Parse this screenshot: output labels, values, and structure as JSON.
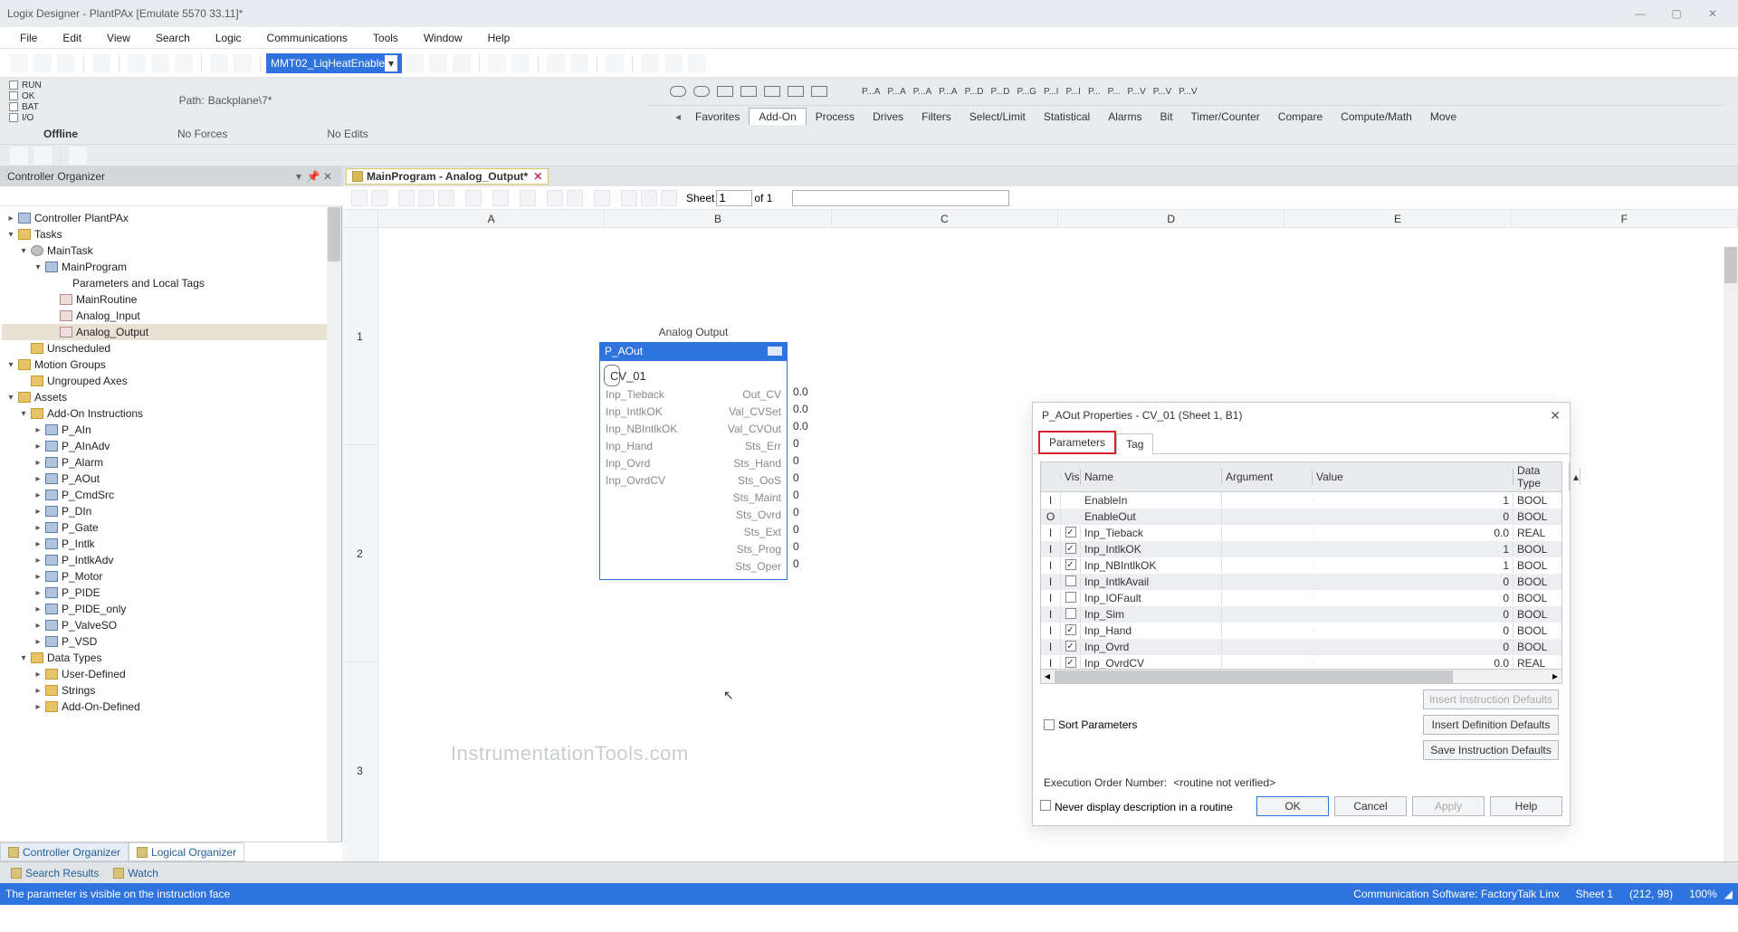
{
  "title": "Logix Designer - PlantPAx [Emulate 5570 33.11]*",
  "menu": [
    "File",
    "Edit",
    "View",
    "Search",
    "Logic",
    "Communications",
    "Tools",
    "Window",
    "Help"
  ],
  "address_dd": "MMT02_LiqHeatEnable",
  "status_leds": [
    "RUN",
    "OK",
    "BAT",
    "I/O"
  ],
  "path_label": "Path:",
  "path_value": "Backplane\\7*",
  "offline": "Offline",
  "noforces": "No Forces",
  "noedits": "No Edits",
  "inst_text": [
    "P...A",
    "P...A",
    "P...A",
    "P...A",
    "P...D",
    "P...D",
    "P...G",
    "P...I",
    "P...I",
    "P...",
    "P...",
    "P...V",
    "P...V",
    "P...V"
  ],
  "inst_tabs": [
    "Favorites",
    "Add-On",
    "Process",
    "Drives",
    "Filters",
    "Select/Limit",
    "Statistical",
    "Alarms",
    "Bit",
    "Timer/Counter",
    "Compare",
    "Compute/Math",
    "Move"
  ],
  "inst_tab_active": "Add-On",
  "organizer": {
    "title": "Controller Organizer",
    "tree": [
      {
        "lvl": 0,
        "tw": "▸",
        "ic": "ctrl",
        "label": "Controller PlantPAx"
      },
      {
        "lvl": 0,
        "tw": "▾",
        "ic": "folder",
        "label": "Tasks"
      },
      {
        "lvl": 1,
        "tw": "▾",
        "ic": "gear",
        "label": "MainTask"
      },
      {
        "lvl": 2,
        "tw": "▾",
        "ic": "ctrl",
        "label": "MainProgram"
      },
      {
        "lvl": 3,
        "tw": "",
        "ic": "",
        "label": "Parameters and Local Tags",
        "tint": "y"
      },
      {
        "lvl": 3,
        "tw": "",
        "ic": "rung",
        "label": "MainRoutine"
      },
      {
        "lvl": 3,
        "tw": "",
        "ic": "rung",
        "label": "Analog_Input"
      },
      {
        "lvl": 3,
        "tw": "",
        "ic": "rung",
        "label": "Analog_Output",
        "sel": true
      },
      {
        "lvl": 1,
        "tw": "",
        "ic": "folder",
        "label": "Unscheduled"
      },
      {
        "lvl": 0,
        "tw": "▾",
        "ic": "folder",
        "label": "Motion Groups"
      },
      {
        "lvl": 1,
        "tw": "",
        "ic": "folder",
        "label": "Ungrouped Axes"
      },
      {
        "lvl": 0,
        "tw": "▾",
        "ic": "folder",
        "label": "Assets"
      },
      {
        "lvl": 1,
        "tw": "▾",
        "ic": "folder",
        "label": "Add-On Instructions"
      },
      {
        "lvl": 2,
        "tw": "▸",
        "ic": "ctrl",
        "label": "P_AIn"
      },
      {
        "lvl": 2,
        "tw": "▸",
        "ic": "ctrl",
        "label": "P_AInAdv"
      },
      {
        "lvl": 2,
        "tw": "▸",
        "ic": "ctrl",
        "label": "P_Alarm"
      },
      {
        "lvl": 2,
        "tw": "▸",
        "ic": "ctrl",
        "label": "P_AOut"
      },
      {
        "lvl": 2,
        "tw": "▸",
        "ic": "ctrl",
        "label": "P_CmdSrc"
      },
      {
        "lvl": 2,
        "tw": "▸",
        "ic": "ctrl",
        "label": "P_DIn"
      },
      {
        "lvl": 2,
        "tw": "▸",
        "ic": "ctrl",
        "label": "P_Gate"
      },
      {
        "lvl": 2,
        "tw": "▸",
        "ic": "ctrl",
        "label": "P_Intlk"
      },
      {
        "lvl": 2,
        "tw": "▸",
        "ic": "ctrl",
        "label": "P_IntlkAdv"
      },
      {
        "lvl": 2,
        "tw": "▸",
        "ic": "ctrl",
        "label": "P_Motor"
      },
      {
        "lvl": 2,
        "tw": "▸",
        "ic": "ctrl",
        "label": "P_PIDE"
      },
      {
        "lvl": 2,
        "tw": "▸",
        "ic": "ctrl",
        "label": "P_PIDE_only"
      },
      {
        "lvl": 2,
        "tw": "▸",
        "ic": "ctrl",
        "label": "P_ValveSO"
      },
      {
        "lvl": 2,
        "tw": "▸",
        "ic": "ctrl",
        "label": "P_VSD"
      },
      {
        "lvl": 1,
        "tw": "▾",
        "ic": "folder",
        "label": "Data Types"
      },
      {
        "lvl": 2,
        "tw": "▸",
        "ic": "folder",
        "label": "User-Defined"
      },
      {
        "lvl": 2,
        "tw": "▸",
        "ic": "folder",
        "label": "Strings"
      },
      {
        "lvl": 2,
        "tw": "▸",
        "ic": "folder",
        "label": "Add-On-Defined"
      }
    ],
    "tabs": [
      "Controller Organizer",
      "Logical Organizer"
    ]
  },
  "bottomtabs": [
    "Search Results",
    "Watch"
  ],
  "statusbar": {
    "msg": "The parameter is visible on the instruction face",
    "comm": "Communication Software: FactoryTalk Linx",
    "sheet": "Sheet 1",
    "coord": "(212, 98)",
    "zoom": "100%"
  },
  "editor": {
    "tab": "MainProgram - Analog_Output*",
    "sheet_label": "Sheet",
    "sheet_val": "1",
    "sheet_of": "of  1",
    "cols": [
      "A",
      "B",
      "C",
      "D",
      "E",
      "F"
    ],
    "rows": [
      "1",
      "2",
      "3"
    ],
    "fblock": {
      "caption": "Analog Output",
      "name": "P_AOut",
      "tag": "CV_01",
      "ioL": [
        "Inp_Tieback",
        "Inp_IntlkOK",
        "Inp_NBIntlkOK",
        "Inp_Hand",
        "Inp_Ovrd",
        "Inp_OvrdCV"
      ],
      "ioR": [
        "Out_CV",
        "Val_CVSet",
        "Val_CVOut",
        "Sts_Err",
        "Sts_Hand",
        "Sts_OoS",
        "Sts_Maint",
        "Sts_Ovrd",
        "Sts_Ext",
        "Sts_Prog",
        "Sts_Oper"
      ],
      "outvals": [
        "0.0",
        "0.0",
        "0.0",
        "0",
        "0",
        "0",
        "0",
        "0",
        "0",
        "0",
        "0"
      ]
    },
    "watermark": "InstrumentationTools.com"
  },
  "dialog": {
    "title": "P_AOut Properties - CV_01 (Sheet 1, B1)",
    "tabs": [
      "Parameters",
      "Tag"
    ],
    "active_tab": "Parameters",
    "headers": [
      "",
      "Vis",
      "Name",
      "Argument",
      "Value",
      "Data Type"
    ],
    "rows": [
      {
        "t": "I",
        "vis": false,
        "disp": false,
        "name": "EnableIn",
        "arg": "",
        "val": "1",
        "dt": "BOOL"
      },
      {
        "t": "O",
        "vis": false,
        "disp": false,
        "name": "EnableOut",
        "arg": "",
        "val": "0",
        "dt": "BOOL"
      },
      {
        "t": "I",
        "vis": true,
        "disp": true,
        "name": "Inp_Tieback",
        "arg": "",
        "val": "0.0",
        "dt": "REAL"
      },
      {
        "t": "I",
        "vis": true,
        "disp": true,
        "name": "Inp_IntlkOK",
        "arg": "",
        "val": "1",
        "dt": "BOOL"
      },
      {
        "t": "I",
        "vis": true,
        "disp": true,
        "name": "Inp_NBIntlkOK",
        "arg": "",
        "val": "1",
        "dt": "BOOL"
      },
      {
        "t": "I",
        "vis": false,
        "disp": true,
        "name": "Inp_IntlkAvail",
        "arg": "",
        "val": "0",
        "dt": "BOOL"
      },
      {
        "t": "I",
        "vis": false,
        "disp": true,
        "name": "Inp_IOFault",
        "arg": "",
        "val": "0",
        "dt": "BOOL"
      },
      {
        "t": "I",
        "vis": false,
        "disp": true,
        "name": "Inp_Sim",
        "arg": "",
        "val": "0",
        "dt": "BOOL"
      },
      {
        "t": "I",
        "vis": true,
        "disp": true,
        "name": "Inp_Hand",
        "arg": "",
        "val": "0",
        "dt": "BOOL"
      },
      {
        "t": "I",
        "vis": true,
        "disp": true,
        "name": "Inp_Ovrd",
        "arg": "",
        "val": "0",
        "dt": "BOOL"
      },
      {
        "t": "I",
        "vis": true,
        "disp": true,
        "name": "Inp_OvrdCV",
        "arg": "",
        "val": "0.0",
        "dt": "REAL"
      }
    ],
    "sort": "Sort Parameters",
    "btns": [
      "Insert Instruction Defaults",
      "Insert Definition Defaults",
      "Save Instruction Defaults"
    ],
    "exec_label": "Execution Order Number:",
    "exec_val": "<routine not verified>",
    "never": "Never display description in a routine",
    "botbtns": [
      "OK",
      "Cancel",
      "Apply",
      "Help"
    ]
  }
}
